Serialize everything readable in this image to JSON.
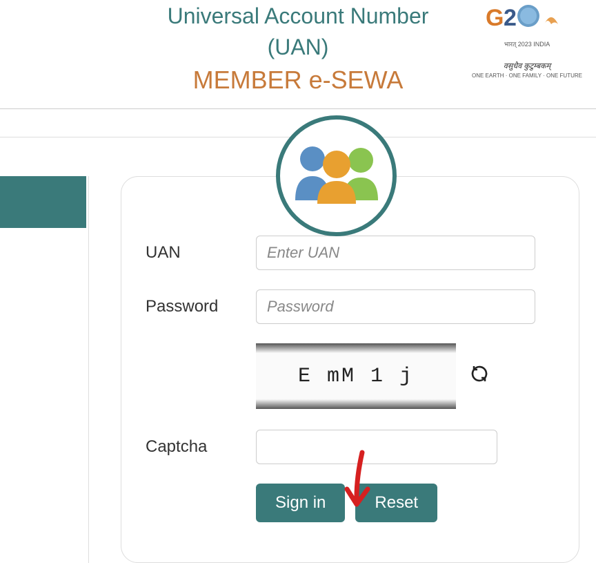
{
  "header": {
    "title1": "Universal Account Number",
    "title2": "(UAN)",
    "title3": "MEMBER e-SEWA"
  },
  "g20": {
    "subtext1": "भारत् 2023 INDIA",
    "subtext2": "वसुधैव कुटुम्बकम्",
    "subtext3": "ONE EARTH · ONE FAMILY · ONE FUTURE"
  },
  "form": {
    "uan_label": "UAN",
    "uan_placeholder": "Enter UAN",
    "password_label": "Password",
    "password_placeholder": "Password",
    "captcha_label": "Captcha",
    "captcha_text": "E mM 1 j",
    "signin_label": "Sign in",
    "reset_label": "Reset"
  }
}
